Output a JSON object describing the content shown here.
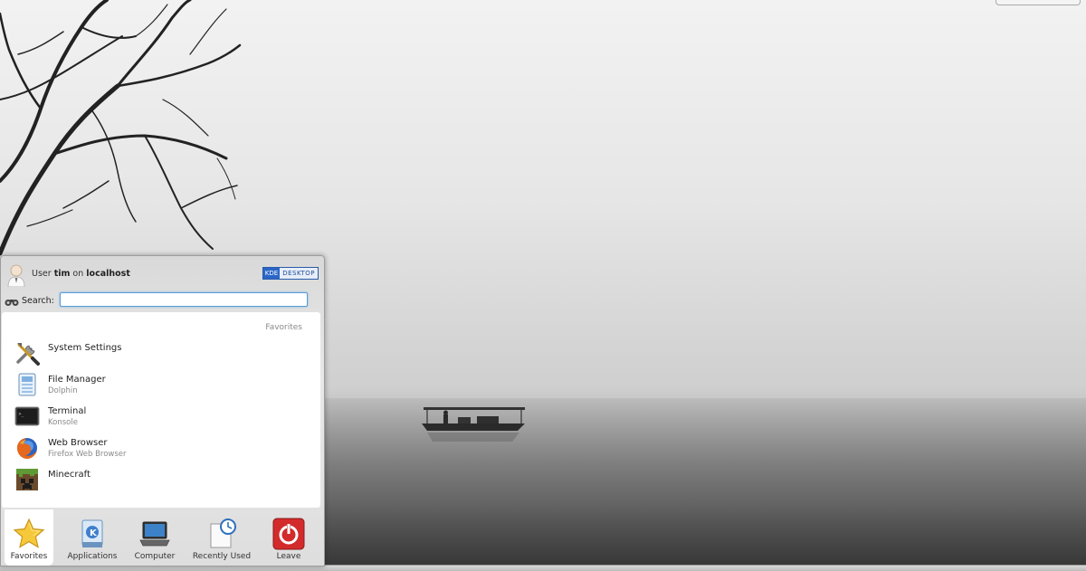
{
  "launcher": {
    "user_prefix": "User",
    "user_name": "tim",
    "user_on": "on",
    "host": "localhost",
    "badge_k": "KDE",
    "badge_desktop": "DESKTOP",
    "search_label": "Search:",
    "search_value": "",
    "section_title": "Favorites",
    "favorites": [
      {
        "name": "System Settings",
        "subtitle": "",
        "icon": "system-settings-icon"
      },
      {
        "name": "File Manager",
        "subtitle": "Dolphin",
        "icon": "file-manager-icon"
      },
      {
        "name": "Terminal",
        "subtitle": "Konsole",
        "icon": "terminal-icon"
      },
      {
        "name": "Web Browser",
        "subtitle": "Firefox Web Browser",
        "icon": "firefox-icon"
      },
      {
        "name": "Minecraft",
        "subtitle": "",
        "icon": "minecraft-icon"
      }
    ],
    "tabs": [
      {
        "label": "Favorites",
        "icon": "star-icon",
        "active": true
      },
      {
        "label": "Applications",
        "icon": "applications-icon",
        "active": false
      },
      {
        "label": "Computer",
        "icon": "laptop-icon",
        "active": false
      },
      {
        "label": "Recently Used",
        "icon": "recent-document-icon",
        "active": false
      },
      {
        "label": "Leave",
        "icon": "power-icon",
        "active": false
      }
    ]
  }
}
